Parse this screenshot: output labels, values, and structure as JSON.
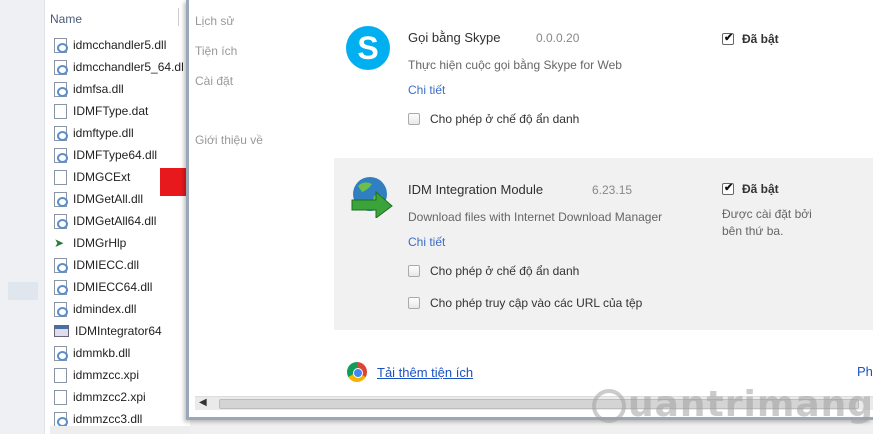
{
  "explorer": {
    "column_header": "Name",
    "files": [
      {
        "name": "idmcchandler5.dll",
        "icon": "dll"
      },
      {
        "name": "idmcchandler5_64.dl",
        "icon": "dll"
      },
      {
        "name": "idmfsa.dll",
        "icon": "dll"
      },
      {
        "name": "IDMFType.dat",
        "icon": "file"
      },
      {
        "name": "idmftype.dll",
        "icon": "dll"
      },
      {
        "name": "IDMFType64.dll",
        "icon": "dll"
      },
      {
        "name": "IDMGCExt",
        "icon": "file"
      },
      {
        "name": "IDMGetAll.dll",
        "icon": "dll"
      },
      {
        "name": "IDMGetAll64.dll",
        "icon": "dll"
      },
      {
        "name": "IDMGrHlp",
        "icon": "grhlp"
      },
      {
        "name": "IDMIECC.dll",
        "icon": "dll"
      },
      {
        "name": "IDMIECC64.dll",
        "icon": "dll"
      },
      {
        "name": "idmindex.dll",
        "icon": "dll"
      },
      {
        "name": "IDMIntegrator64",
        "icon": "exe"
      },
      {
        "name": "idmmkb.dll",
        "icon": "dll"
      },
      {
        "name": "idmmzcc.xpi",
        "icon": "file"
      },
      {
        "name": "idmmzcc2.xpi",
        "icon": "file"
      },
      {
        "name": "idmmzcc3.dll",
        "icon": "dll"
      }
    ]
  },
  "chrome": {
    "nav": {
      "history": "Lịch sử",
      "extensions": "Tiện ích",
      "settings": "Cài đặt",
      "about": "Giới thiệu về"
    },
    "extensions": [
      {
        "name": "Gọi bằng Skype",
        "version": "0.0.0.20",
        "description": "Thực hiện cuộc gọi bằng Skype for Web",
        "details": "Chi tiết",
        "incognito": "Cho phép ở chế độ ẩn danh",
        "enabled_label": "Đã bật"
      },
      {
        "name": "IDM Integration Module",
        "version": "6.23.15",
        "description": "Download files with Internet Download Manager",
        "details": "Chi tiết",
        "incognito": "Cho phép ở chế độ ẩn danh",
        "file_urls": "Cho phép truy cập vào các URL của tệp",
        "enabled_label": "Đã bật",
        "installed_by": "Được cài đặt bởi bên thứ ba."
      }
    ],
    "get_more": "Tải thêm tiện ích",
    "right_cut": "Ph"
  },
  "colors": {
    "arrow": "#e8191c",
    "link": "#1a52c4",
    "skype": "#00aff0"
  },
  "watermark": "uantrimang"
}
